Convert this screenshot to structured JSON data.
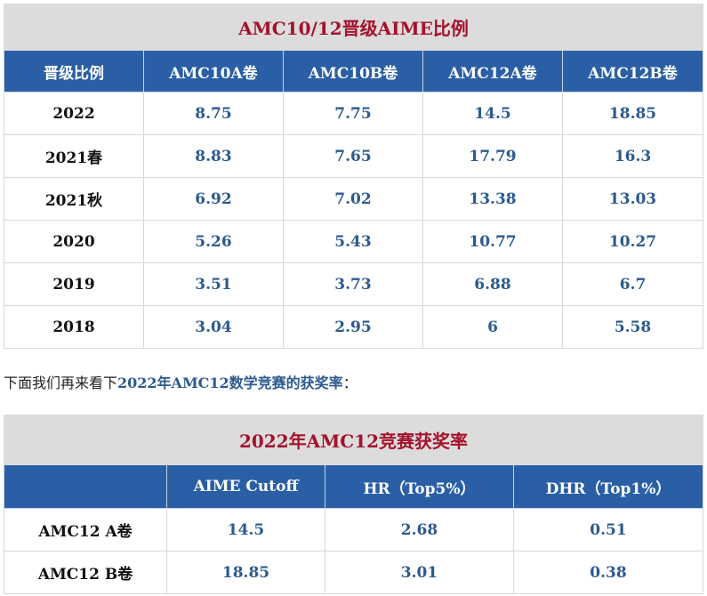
{
  "table1": {
    "title": "AMC10/12晋级AIME比例",
    "headers": [
      "晋级比例",
      "AMC10A卷",
      "AMC10B卷",
      "AMC12A卷",
      "AMC12B卷"
    ],
    "rows": [
      {
        "label": "2022",
        "values": [
          "8.75",
          "7.75",
          "14.5",
          "18.85"
        ]
      },
      {
        "label": "2021春",
        "values": [
          "8.83",
          "7.65",
          "17.79",
          "16.3"
        ]
      },
      {
        "label": "2021秋",
        "values": [
          "6.92",
          "7.02",
          "13.38",
          "13.03"
        ]
      },
      {
        "label": "2020",
        "values": [
          "5.26",
          "5.43",
          "10.77",
          "10.27"
        ]
      },
      {
        "label": "2019",
        "values": [
          "3.51",
          "3.73",
          "6.88",
          "6.7"
        ]
      },
      {
        "label": "2018",
        "values": [
          "3.04",
          "2.95",
          "6",
          "5.58"
        ]
      }
    ]
  },
  "intro": {
    "prefix": "下面我们再来看下",
    "highlight": "2022年AMC12数学竞赛的获奖率",
    "suffix": "："
  },
  "table2": {
    "title": "2022年AMC12竞赛获奖率",
    "headers": [
      "",
      "AIME Cutoff",
      "HR（Top5%）",
      "DHR（Top1%）"
    ],
    "rows": [
      {
        "label": "AMC12 A卷",
        "values": [
          "14.5",
          "2.68",
          "0.51"
        ]
      },
      {
        "label": "AMC12 B卷",
        "values": [
          "18.85",
          "3.01",
          "0.38"
        ]
      }
    ]
  },
  "colors": {
    "title_text": "#a3122b",
    "header_bg": "#2a5fa5",
    "value_text": "#2c5a8f"
  }
}
